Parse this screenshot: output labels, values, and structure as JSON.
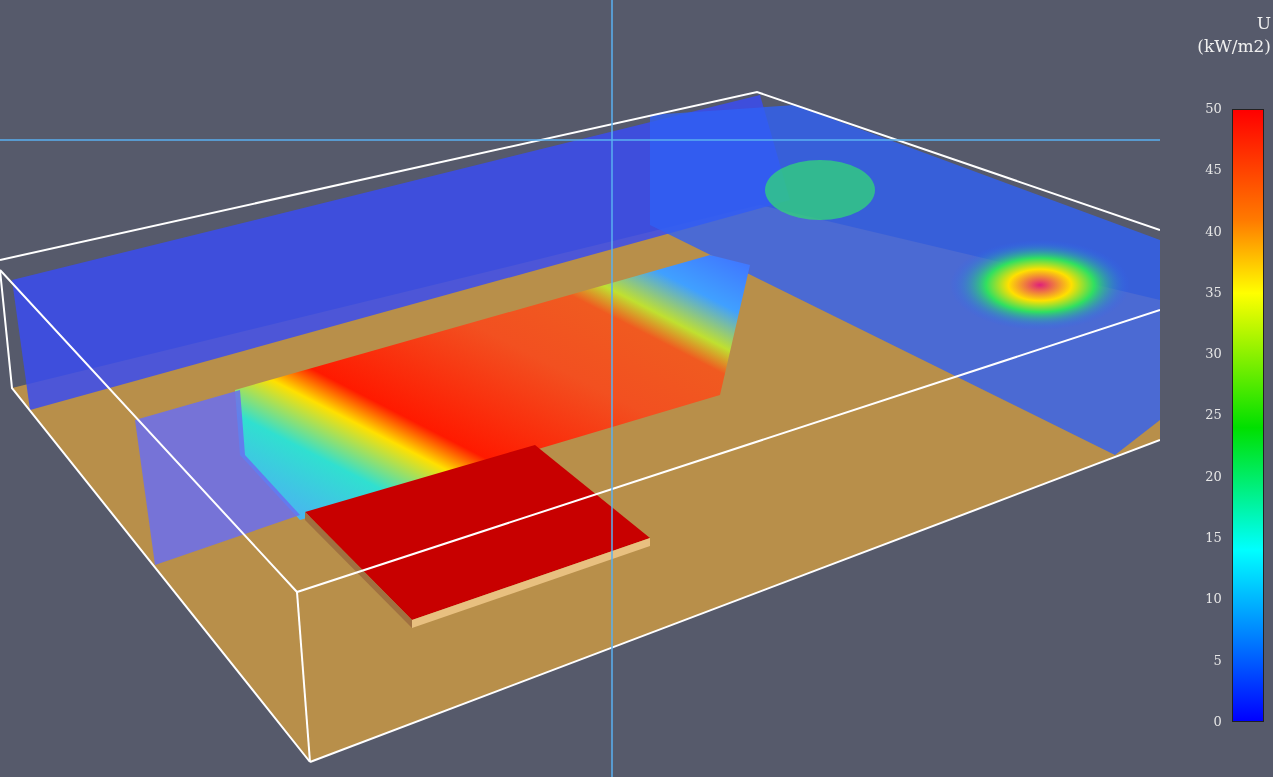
{
  "legend": {
    "title": "U",
    "unit": "(kW/m2)",
    "ticks": [
      "50",
      "45",
      "40",
      "35",
      "30",
      "25",
      "20",
      "15",
      "10",
      "5",
      "0"
    ]
  }
}
